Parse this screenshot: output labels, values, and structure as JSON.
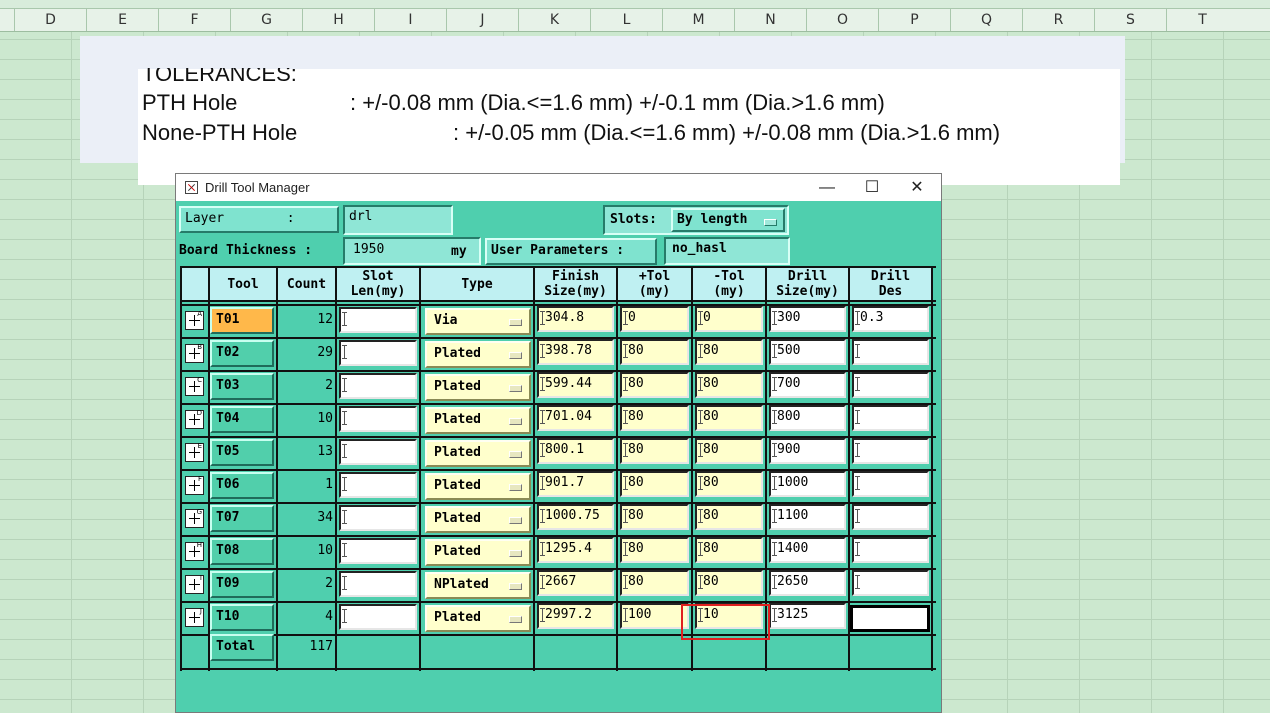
{
  "spreadsheet": {
    "columns": [
      "D",
      "E",
      "F",
      "G",
      "H",
      "I",
      "J",
      "K",
      "L",
      "M",
      "N",
      "O",
      "P",
      "Q",
      "R",
      "S",
      "T"
    ]
  },
  "tolerances": {
    "heading": "TOLERANCES:",
    "pth_label": "PTH Hole",
    "pth_value": ": +/-0.08 mm (Dia.<=1.6 mm) +/-0.1 mm (Dia.>1.6 mm)",
    "npth_label": "None-PTH Hole",
    "npth_value": ": +/-0.05 mm (Dia.<=1.6 mm) +/-0.08 mm (Dia.>1.6 mm)"
  },
  "window": {
    "title": "Drill Tool Manager",
    "minimize": "—",
    "maximize": "☐",
    "close": "✕"
  },
  "params": {
    "layer_label": "Layer        :",
    "layer_value": "drl",
    "slots_label": "Slots:",
    "slots_value": "By length",
    "thickness_label": "Board Thickness :",
    "thickness_value": "1950",
    "thickness_unit": "my",
    "user_params_label": "User Parameters :",
    "user_params_value": "no_hasl"
  },
  "table": {
    "headers": {
      "tool": "Tool",
      "count": "Count",
      "slot_len": "Slot\nLen(my)",
      "type": "Type",
      "finish": "Finish\nSize(my)",
      "ptol": "+Tol\n(my)",
      "mtol": "-Tol\n(my)",
      "drill_size": "Drill\nSize(my)",
      "drill_des": "Drill\nDes"
    },
    "rows": [
      {
        "sup": "A",
        "tool": "T01",
        "count": "12",
        "slot": "",
        "type": "Via",
        "finish": "304.8",
        "ptol": "0",
        "mtol": "0",
        "drill": "300",
        "des": "0.3"
      },
      {
        "sup": "B",
        "tool": "T02",
        "count": "29",
        "slot": "",
        "type": "Plated",
        "finish": "398.78",
        "ptol": "80",
        "mtol": "80",
        "drill": "500",
        "des": ""
      },
      {
        "sup": "C",
        "tool": "T03",
        "count": "2",
        "slot": "",
        "type": "Plated",
        "finish": "599.44",
        "ptol": "80",
        "mtol": "80",
        "drill": "700",
        "des": ""
      },
      {
        "sup": "D",
        "tool": "T04",
        "count": "10",
        "slot": "",
        "type": "Plated",
        "finish": "701.04",
        "ptol": "80",
        "mtol": "80",
        "drill": "800",
        "des": ""
      },
      {
        "sup": "E",
        "tool": "T05",
        "count": "13",
        "slot": "",
        "type": "Plated",
        "finish": "800.1",
        "ptol": "80",
        "mtol": "80",
        "drill": "900",
        "des": ""
      },
      {
        "sup": "F",
        "tool": "T06",
        "count": "1",
        "slot": "",
        "type": "Plated",
        "finish": "901.7",
        "ptol": "80",
        "mtol": "80",
        "drill": "1000",
        "des": ""
      },
      {
        "sup": "G",
        "tool": "T07",
        "count": "34",
        "slot": "",
        "type": "Plated",
        "finish": "1000.75",
        "ptol": "80",
        "mtol": "80",
        "drill": "1100",
        "des": ""
      },
      {
        "sup": "H",
        "tool": "T08",
        "count": "10",
        "slot": "",
        "type": "Plated",
        "finish": "1295.4",
        "ptol": "80",
        "mtol": "80",
        "drill": "1400",
        "des": ""
      },
      {
        "sup": "I",
        "tool": "T09",
        "count": "2",
        "slot": "",
        "type": "NPlated",
        "finish": "2667",
        "ptol": "80",
        "mtol": "80",
        "drill": "2650",
        "des": ""
      },
      {
        "sup": "J",
        "tool": "T10",
        "count": "4",
        "slot": "",
        "type": "Plated",
        "finish": "2997.2",
        "ptol": "100",
        "mtol": "10",
        "drill": "3125",
        "des": ""
      }
    ],
    "total_label": "Total",
    "total_count": "117"
  }
}
